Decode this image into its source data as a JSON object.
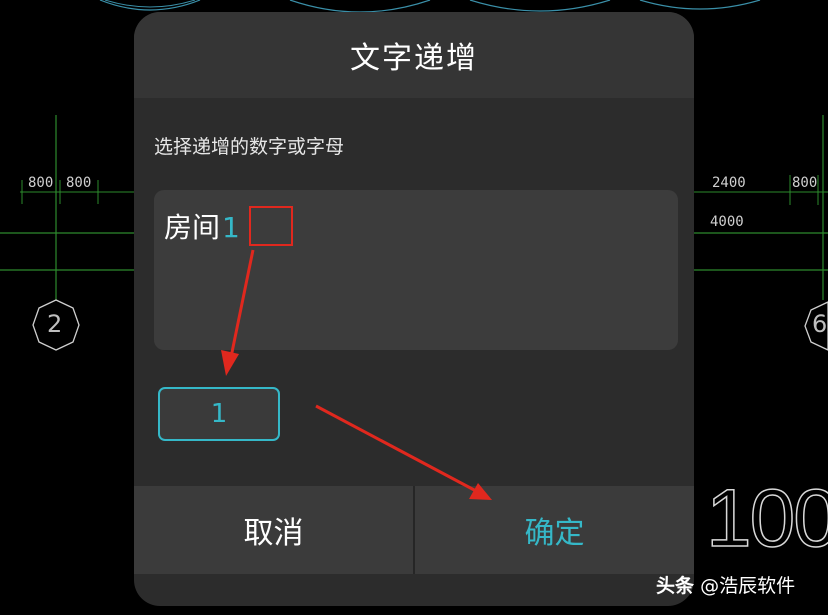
{
  "dialog": {
    "title": "文字递增",
    "instruction": "选择递增的数字或字母",
    "text_prefix": "房间",
    "text_highlight": "1",
    "value_input": "1",
    "cancel_label": "取消",
    "confirm_label": "确定"
  },
  "cad": {
    "dim_left_1": "800",
    "dim_left_2": "800",
    "dim_right_1": "2400",
    "dim_right_2": "800",
    "dim_right_total": "4000",
    "axis_left": "2",
    "axis_right": "6",
    "big_text": "100"
  },
  "watermark": {
    "source": "头条",
    "handle": "@浩辰软件"
  },
  "colors": {
    "accent": "#35b8c8",
    "annotation_red": "#e0281e",
    "dialog_bg": "#2c2c2c"
  }
}
